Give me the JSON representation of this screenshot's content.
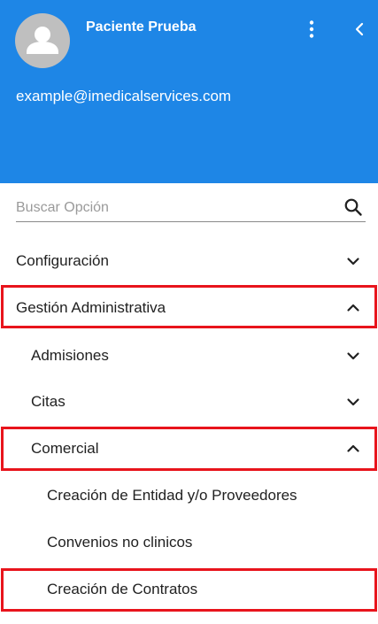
{
  "header": {
    "user_name": "Paciente Prueba",
    "email": "example@imedicalservices.com",
    "avatar_icon": "person-icon",
    "menu_icon": "more-vert-icon",
    "collapse_icon": "chevron-left-icon",
    "background_color": "#1e86e6"
  },
  "search": {
    "placeholder": "Buscar Opción",
    "value": "",
    "icon": "search-icon"
  },
  "menu": {
    "configuracion": {
      "label": "Configuración",
      "state": "collapsed"
    },
    "gestion": {
      "label": "Gestión Administrativa",
      "state": "expanded"
    },
    "admisiones": {
      "label": "Admisiones",
      "state": "collapsed"
    },
    "citas": {
      "label": "Citas",
      "state": "collapsed"
    },
    "comercial": {
      "label": "Comercial",
      "state": "expanded"
    },
    "creacion_entidad": {
      "label": "Creación de Entidad y/o Proveedores"
    },
    "convenios": {
      "label": "Convenios no clinicos"
    },
    "creacion_contratos": {
      "label": "Creación de Contratos"
    }
  },
  "highlight_color": "#e8141c"
}
